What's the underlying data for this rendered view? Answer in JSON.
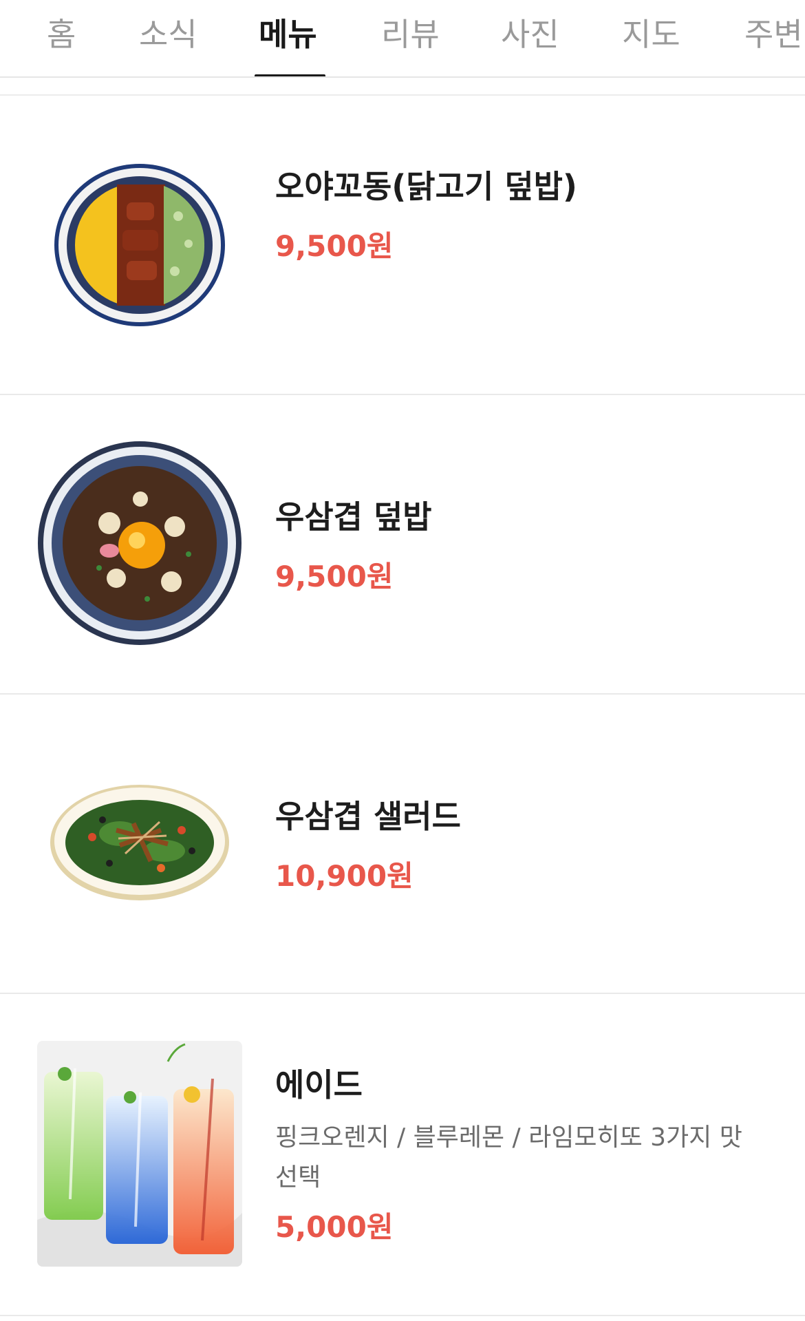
{
  "tabs": [
    {
      "label": "홈",
      "active": false
    },
    {
      "label": "소식",
      "active": false
    },
    {
      "label": "메뉴",
      "active": true
    },
    {
      "label": "리뷰",
      "active": false
    },
    {
      "label": "사진",
      "active": false
    },
    {
      "label": "지도",
      "active": false
    },
    {
      "label": "주변",
      "active": false
    }
  ],
  "menu": {
    "items": [
      {
        "name": "오야꼬동(닭고기 덮밥)",
        "price": "9,500원",
        "image": "chicken-donburi-bowl"
      },
      {
        "name": "우삼겹 덮밥",
        "price": "9,500원",
        "image": "beef-brisket-rice-bowl"
      },
      {
        "name": "우삼겹 샐러드",
        "price": "10,900원",
        "image": "beef-brisket-salad"
      },
      {
        "name": "에이드",
        "description": "핑크오렌지 / 블루레몬 / 라임모히또 3가지 맛 선택",
        "price": "5,000원",
        "image": "three-ade-drinks"
      }
    ]
  },
  "colors": {
    "price": "#e8574b",
    "active_tab": "#1a1a1a",
    "inactive_tab": "#9a9a9a"
  }
}
